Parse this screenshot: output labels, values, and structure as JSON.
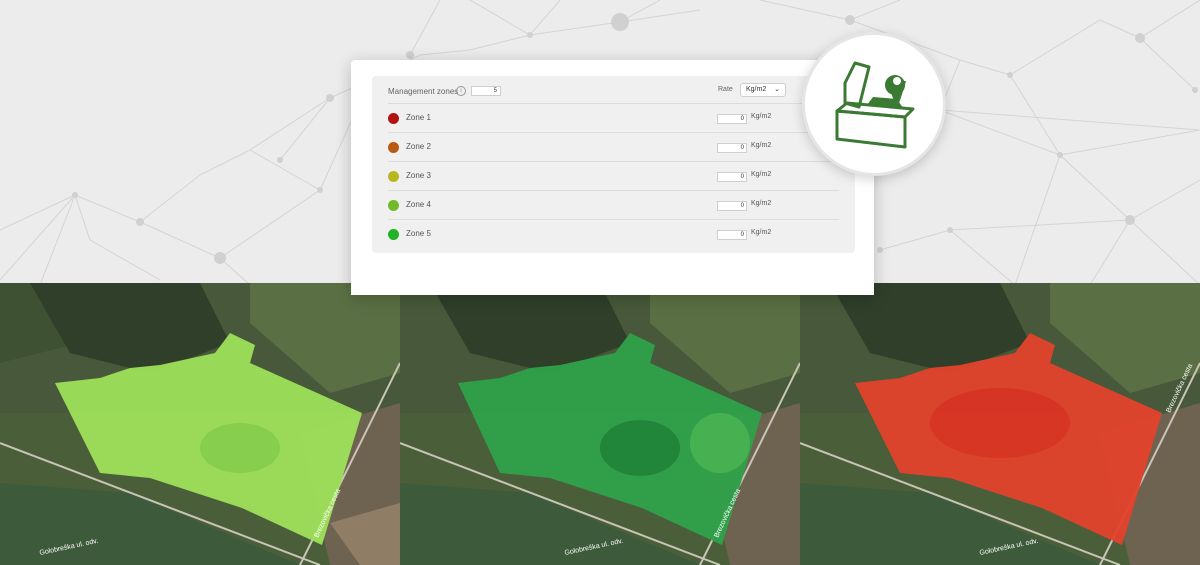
{
  "panel": {
    "management_zones_label": "Management zones",
    "management_zones_value": "5",
    "rate_label": "Rate",
    "unit_select_value": "Kg/m2"
  },
  "zones": [
    {
      "name": "Zone 1",
      "value": "0",
      "unit": "Kg/m2",
      "color": "#b31212"
    },
    {
      "name": "Zone 2",
      "value": "0",
      "unit": "Kg/m2",
      "color": "#b85a12"
    },
    {
      "name": "Zone 3",
      "value": "0",
      "unit": "Kg/m2",
      "color": "#b8b81e"
    },
    {
      "name": "Zone 4",
      "value": "0",
      "unit": "Kg/m2",
      "color": "#72b82a"
    },
    {
      "name": "Zone 5",
      "value": "0",
      "unit": "Kg/m2",
      "color": "#22b228"
    }
  ],
  "maps": [
    {
      "road_label_1": "Golobreška ul. odv.",
      "road_label_2": "Brezovička cesta",
      "field_color": "#9ee05a"
    },
    {
      "road_label_1": "Golobreška ul. odv.",
      "road_label_2": "Brezovička cesta",
      "field_color": "#2fa14a"
    },
    {
      "road_label_1": "Golobreška ul. odv.",
      "road_label_2": "Brezovička cesta",
      "field_color": "#e3422b"
    }
  ],
  "icons": {
    "badge": "field-location-pin-icon",
    "info": "info-icon",
    "chevron": "chevron-down-icon"
  }
}
